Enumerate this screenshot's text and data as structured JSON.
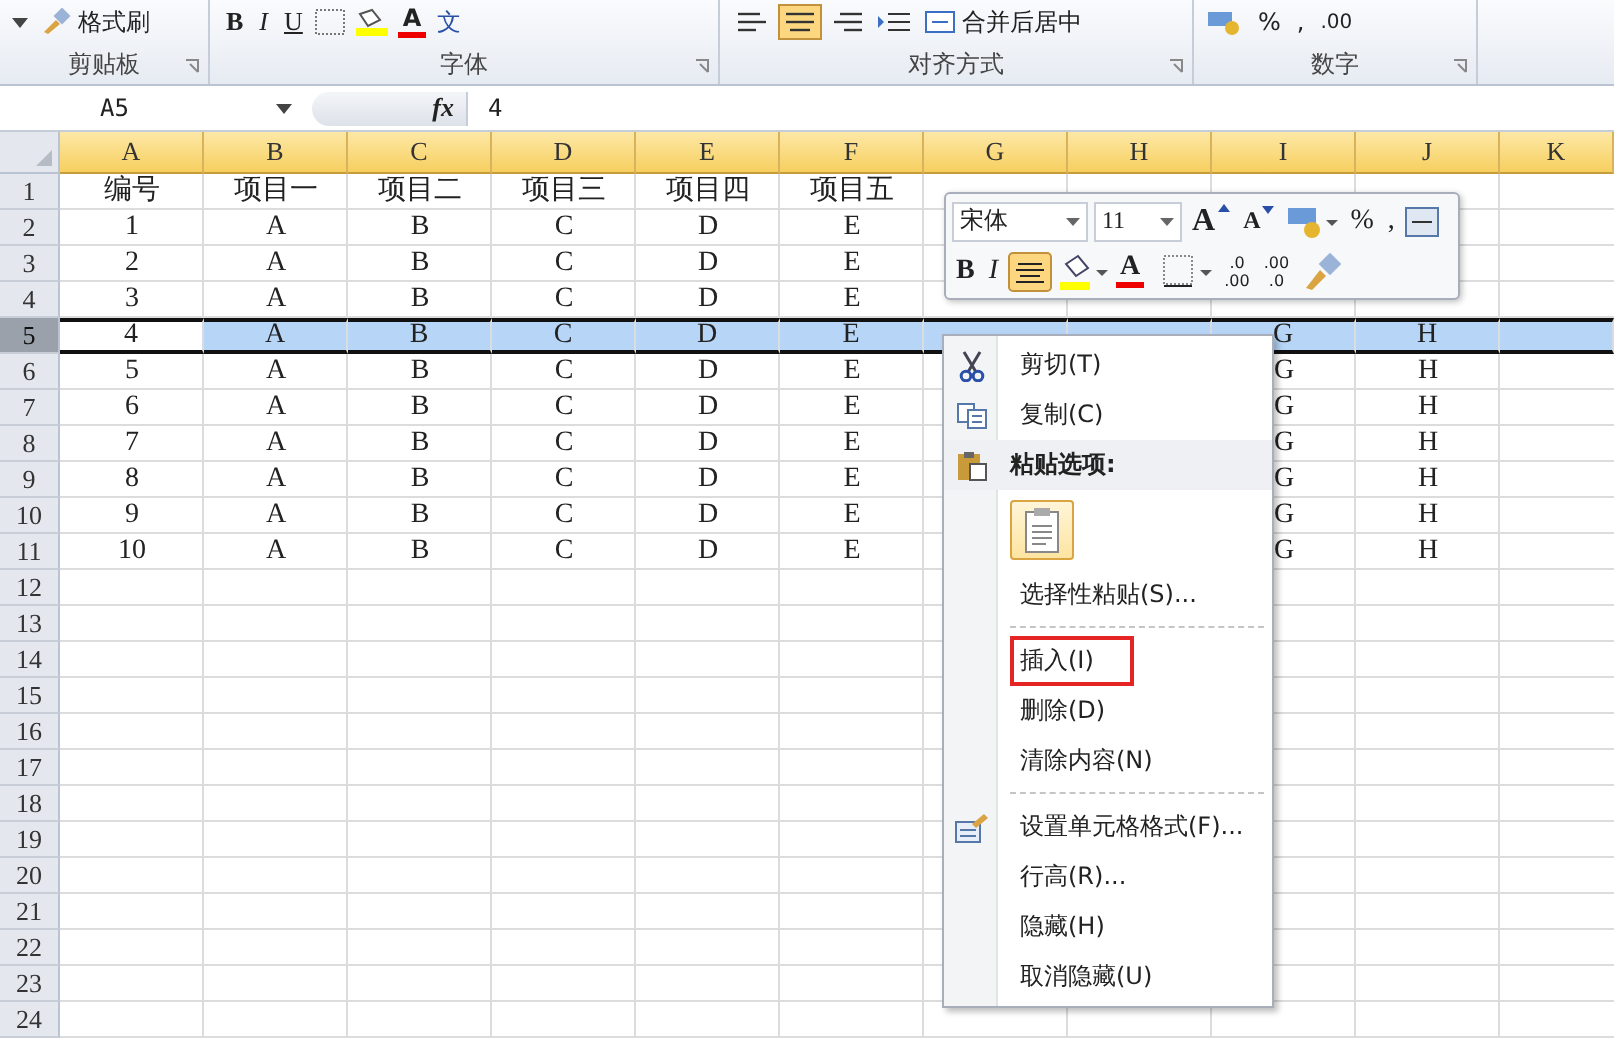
{
  "ribbon": {
    "groups": [
      {
        "label": "剪贴板",
        "items": [
          {
            "kind": "caret"
          },
          {
            "kind": "brush",
            "text": "格式刷"
          }
        ]
      },
      {
        "label": "字体",
        "items": [
          {
            "kind": "bold",
            "text": "B"
          },
          {
            "kind": "italic",
            "text": "I"
          },
          {
            "kind": "underline",
            "text": "U"
          },
          {
            "kind": "border"
          },
          {
            "kind": "fill"
          },
          {
            "kind": "fontcolor",
            "text": "A"
          },
          {
            "kind": "wen",
            "text": "文"
          }
        ]
      },
      {
        "label": "对齐方式",
        "items": [
          {
            "kind": "align-left"
          },
          {
            "kind": "align-center",
            "selected": true
          },
          {
            "kind": "align-right"
          },
          {
            "kind": "indent"
          },
          {
            "kind": "merge",
            "text": "合并后居中"
          }
        ]
      },
      {
        "label": "数字",
        "items": [
          {
            "kind": "currency"
          },
          {
            "kind": "text",
            "text": "%"
          },
          {
            "kind": "text",
            "text": ","
          },
          {
            "kind": "decimal",
            "text": ".00"
          }
        ]
      }
    ]
  },
  "formula_bar": {
    "name_box": "A5",
    "fx": "fx",
    "formula": "4"
  },
  "columns": [
    "A",
    "B",
    "C",
    "D",
    "E",
    "F",
    "G",
    "H",
    "I",
    "J",
    "K"
  ],
  "rows": [
    {
      "header": "1",
      "selected": false,
      "cells": {
        "A": "编号",
        "B": "项目一",
        "C": "项目二",
        "D": "项目三",
        "E": "项目四",
        "F": "项目五"
      }
    },
    {
      "header": "2",
      "selected": false,
      "cells": {
        "A": "1",
        "B": "A",
        "C": "B",
        "D": "C",
        "E": "D",
        "F": "E"
      }
    },
    {
      "header": "3",
      "selected": false,
      "cells": {
        "A": "2",
        "B": "A",
        "C": "B",
        "D": "C",
        "E": "D",
        "F": "E"
      }
    },
    {
      "header": "4",
      "selected": false,
      "cells": {
        "A": "3",
        "B": "A",
        "C": "B",
        "D": "C",
        "E": "D",
        "F": "E"
      }
    },
    {
      "header": "5",
      "selected": true,
      "cells": {
        "A": "4",
        "B": "A",
        "C": "B",
        "D": "C",
        "E": "D",
        "F": "E",
        "I": "G",
        "J": "H"
      }
    },
    {
      "header": "6",
      "selected": false,
      "cells": {
        "A": "5",
        "B": "A",
        "C": "B",
        "D": "C",
        "E": "D",
        "F": "E",
        "I": "G",
        "J": "H"
      }
    },
    {
      "header": "7",
      "selected": false,
      "cells": {
        "A": "6",
        "B": "A",
        "C": "B",
        "D": "C",
        "E": "D",
        "F": "E",
        "I": "G",
        "J": "H"
      }
    },
    {
      "header": "8",
      "selected": false,
      "cells": {
        "A": "7",
        "B": "A",
        "C": "B",
        "D": "C",
        "E": "D",
        "F": "E",
        "I": "G",
        "J": "H"
      }
    },
    {
      "header": "9",
      "selected": false,
      "cells": {
        "A": "8",
        "B": "A",
        "C": "B",
        "D": "C",
        "E": "D",
        "F": "E",
        "I": "G",
        "J": "H"
      }
    },
    {
      "header": "10",
      "selected": false,
      "cells": {
        "A": "9",
        "B": "A",
        "C": "B",
        "D": "C",
        "E": "D",
        "F": "E",
        "I": "G",
        "J": "H"
      }
    },
    {
      "header": "11",
      "selected": false,
      "cells": {
        "A": "10",
        "B": "A",
        "C": "B",
        "D": "C",
        "E": "D",
        "F": "E",
        "I": "G",
        "J": "H"
      }
    },
    {
      "header": "12",
      "selected": false,
      "cells": {}
    },
    {
      "header": "13",
      "selected": false,
      "cells": {}
    },
    {
      "header": "14",
      "selected": false,
      "cells": {}
    },
    {
      "header": "15",
      "selected": false,
      "cells": {}
    },
    {
      "header": "16",
      "selected": false,
      "cells": {}
    },
    {
      "header": "17",
      "selected": false,
      "cells": {}
    },
    {
      "header": "18",
      "selected": false,
      "cells": {}
    },
    {
      "header": "19",
      "selected": false,
      "cells": {}
    },
    {
      "header": "20",
      "selected": false,
      "cells": {}
    },
    {
      "header": "21",
      "selected": false,
      "cells": {}
    },
    {
      "header": "22",
      "selected": false,
      "cells": {}
    },
    {
      "header": "23",
      "selected": false,
      "cells": {}
    },
    {
      "header": "24",
      "selected": false,
      "cells": {}
    }
  ],
  "mini_toolbar": {
    "font": "宋体",
    "size": "11",
    "row1": [
      {
        "kind": "grow",
        "text": "A"
      },
      {
        "kind": "shrink",
        "text": "A"
      },
      {
        "kind": "accounting"
      },
      {
        "kind": "text",
        "text": "%"
      },
      {
        "kind": "text",
        "text": ","
      },
      {
        "kind": "merge"
      }
    ],
    "row2": [
      {
        "kind": "bold",
        "text": "B"
      },
      {
        "kind": "italic",
        "text": "I"
      },
      {
        "kind": "center",
        "selected": true
      },
      {
        "kind": "fill"
      },
      {
        "kind": "fontcolor",
        "text": "A"
      },
      {
        "kind": "border"
      },
      {
        "kind": "decimal",
        "top": ".0",
        "bottom": ".00"
      },
      {
        "kind": "decimal",
        "top": ".00",
        "bottom": ".0"
      },
      {
        "kind": "brush"
      }
    ]
  },
  "context_menu": [
    {
      "kind": "item",
      "label": "剪切(T)",
      "highlighted": false
    },
    {
      "kind": "item",
      "label": "复制(C)",
      "highlighted": false
    },
    {
      "kind": "header",
      "label": "粘贴选项:"
    },
    {
      "kind": "paste"
    },
    {
      "kind": "item",
      "label": "选择性粘贴(S)...",
      "highlighted": false
    },
    {
      "kind": "separator"
    },
    {
      "kind": "item",
      "label": "插入(I)",
      "highlighted": true
    },
    {
      "kind": "item",
      "label": "删除(D)",
      "highlighted": false
    },
    {
      "kind": "item",
      "label": "清除内容(N)",
      "highlighted": false
    },
    {
      "kind": "separator"
    },
    {
      "kind": "item",
      "label": "设置单元格格式(F)...",
      "highlighted": false
    },
    {
      "kind": "item",
      "label": "行高(R)...",
      "highlighted": false
    },
    {
      "kind": "item",
      "label": "隐藏(H)",
      "highlighted": false
    },
    {
      "kind": "item",
      "label": "取消隐藏(U)",
      "highlighted": false
    }
  ]
}
